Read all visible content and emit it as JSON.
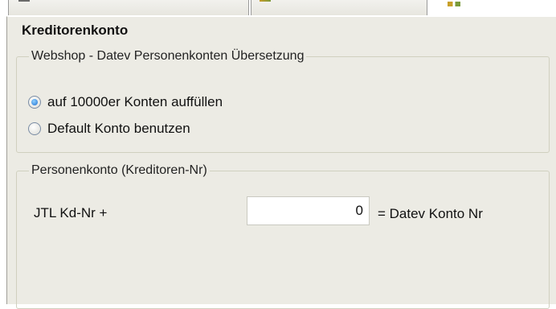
{
  "tabs": [
    {
      "label": "",
      "icon": "tab-icon"
    },
    {
      "label": "",
      "icon": "people-icon"
    }
  ],
  "panel": {
    "title": "Kreditorenkonto"
  },
  "group1": {
    "legend": "Webshop - Datev Personenkonten Übersetzung",
    "options": [
      {
        "label": "auf 10000er Konten auffüllen",
        "checked": true
      },
      {
        "label": "Default Konto benutzen",
        "checked": false
      }
    ]
  },
  "group2": {
    "legend": "Personenkonto (Kreditoren-Nr)",
    "prefix_label": "JTL Kd-Nr +",
    "value": "0",
    "suffix_label": "= Datev Konto Nr"
  },
  "colors": {
    "panel_bg": "#ecebe4",
    "group_border": "#d0d0bf",
    "radio_accent": "#1e6fd0"
  }
}
